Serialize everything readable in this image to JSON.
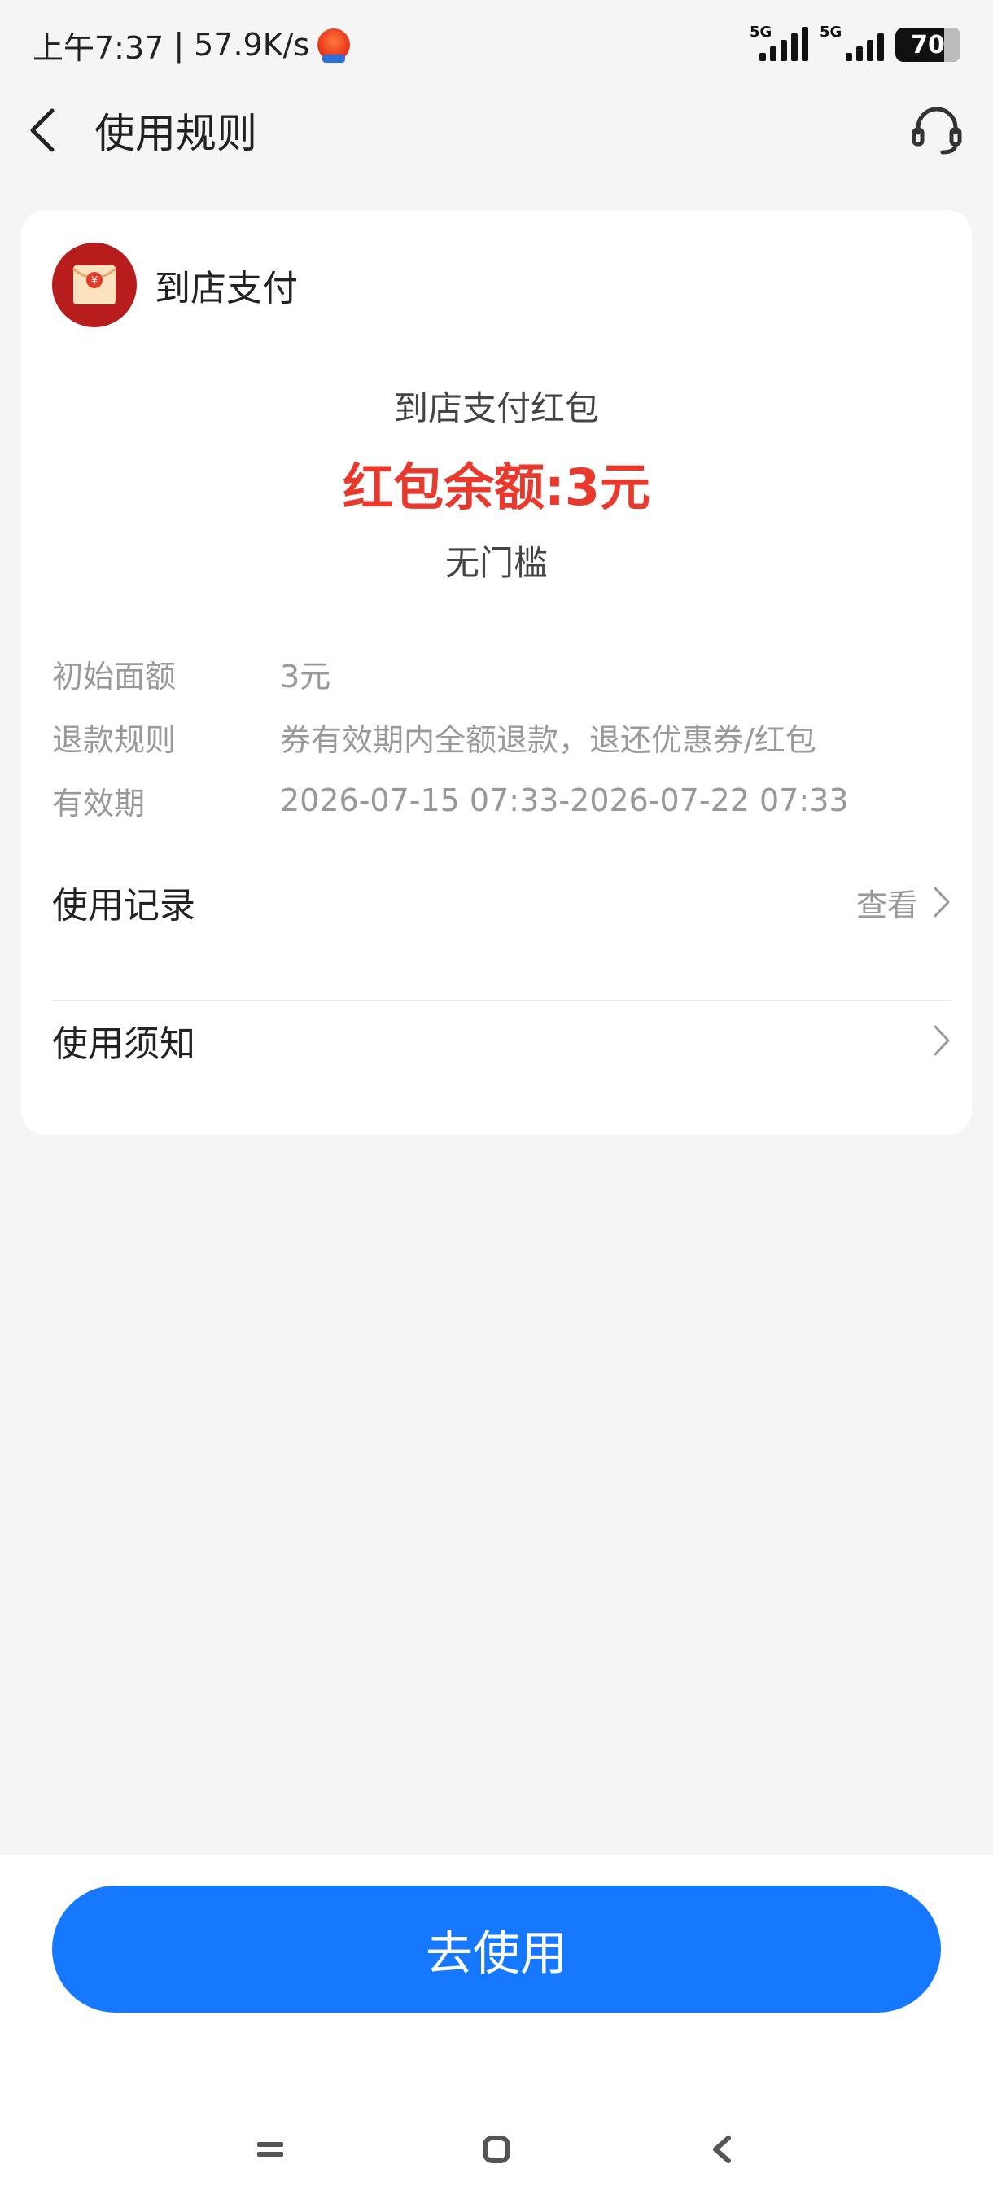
{
  "status_bar": {
    "time": "上午7:37",
    "speed": "57.9K/s",
    "network_1": "5G",
    "network_2": "5G",
    "battery": "70"
  },
  "header": {
    "title": "使用规则"
  },
  "merchant": {
    "name": "到店支付",
    "logo_color": "#b81d1d"
  },
  "coupon": {
    "title": "到店支付红包",
    "balance": "红包余额:3元",
    "threshold": "无门槛"
  },
  "details": [
    {
      "label": "初始面额",
      "value": "3元"
    },
    {
      "label": "退款规则",
      "value": "券有效期内全额退款，退还优惠券/红包"
    },
    {
      "label": "有效期",
      "value": "2026-07-15 07:33-2026-07-22 07:33"
    }
  ],
  "menu": {
    "records_label": "使用记录",
    "records_action": "查看",
    "notice_label": "使用须知"
  },
  "actions": {
    "use_label": "去使用"
  },
  "colors": {
    "accent": "#1677ff",
    "balance_red": "#e8392c",
    "page_bg": "#f5f5f5"
  }
}
